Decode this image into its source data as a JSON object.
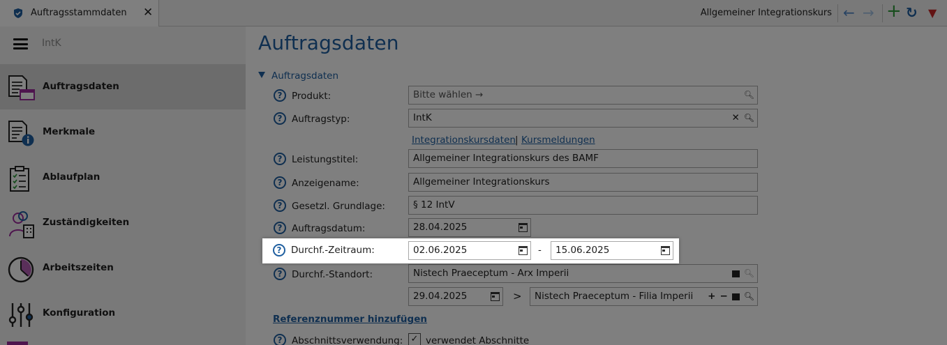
{
  "tab": {
    "title": "Auftragsstammdaten",
    "close": "✕"
  },
  "header": {
    "title": "Allgemeiner Integrationskurs"
  },
  "toolbar": {
    "back": "←",
    "forward": "→",
    "add": "+",
    "refresh": "↻",
    "menu": "▼"
  },
  "sidebar": {
    "breadcrumb": "IntK",
    "items": [
      {
        "label": "Auftragsdaten",
        "icon": "document-window-icon"
      },
      {
        "label": "Merkmale",
        "icon": "document-info-icon"
      },
      {
        "label": "Ablaufplan",
        "icon": "clipboard-checklist-icon"
      },
      {
        "label": "Zuständigkeiten",
        "icon": "person-building-icon"
      },
      {
        "label": "Arbeitszeiten",
        "icon": "clock-icon"
      },
      {
        "label": "Konfiguration",
        "icon": "sliders-icon"
      }
    ]
  },
  "main": {
    "title": "Auftragsdaten",
    "section": "Auftragsdaten",
    "help_glyph": "?",
    "fields": {
      "produkt": {
        "label": "Produkt:",
        "value": "Bitte wählen →"
      },
      "auftragstyp": {
        "label": "Auftragstyp:",
        "value": "IntK"
      },
      "links": {
        "kursdaten": "Integrationskursdaten",
        "sep": "|",
        "meldungen": "Kursmeldungen"
      },
      "leistungstitel": {
        "label": "Leistungstitel:",
        "value": "Allgemeiner Integrationskurs des BAMF"
      },
      "anzeigename": {
        "label": "Anzeigename:",
        "value": "Allgemeiner Integrationskurs"
      },
      "grundlage": {
        "label": "Gesetzl. Grundlage:",
        "value": "§ 12 IntV"
      },
      "auftragsdatum": {
        "label": "Auftragsdatum:",
        "value": "28.04.2025"
      },
      "zeitraum": {
        "label": "Durchf.-Zeitraum:",
        "from": "02.06.2025",
        "dash": "-",
        "to": "15.06.2025"
      },
      "standort": {
        "label": "Durchf.-Standort:",
        "value": "Nistech Praeceptum - Arx Imperii"
      },
      "standort2": {
        "date": "29.04.2025",
        "arrow": ">",
        "value": "Nistech Praeceptum - Filia Imperii",
        "plus": "+",
        "minus": "−"
      },
      "referenz_link": "Referenznummer hinzufügen",
      "abschnitt": {
        "label": "Abschnittsverwendung:",
        "checkmark": "✓",
        "value": "verwendet Abschnitte"
      }
    }
  },
  "colors": {
    "accent": "#1f5fa0",
    "green": "#2e9b3a",
    "red": "#c62828"
  }
}
